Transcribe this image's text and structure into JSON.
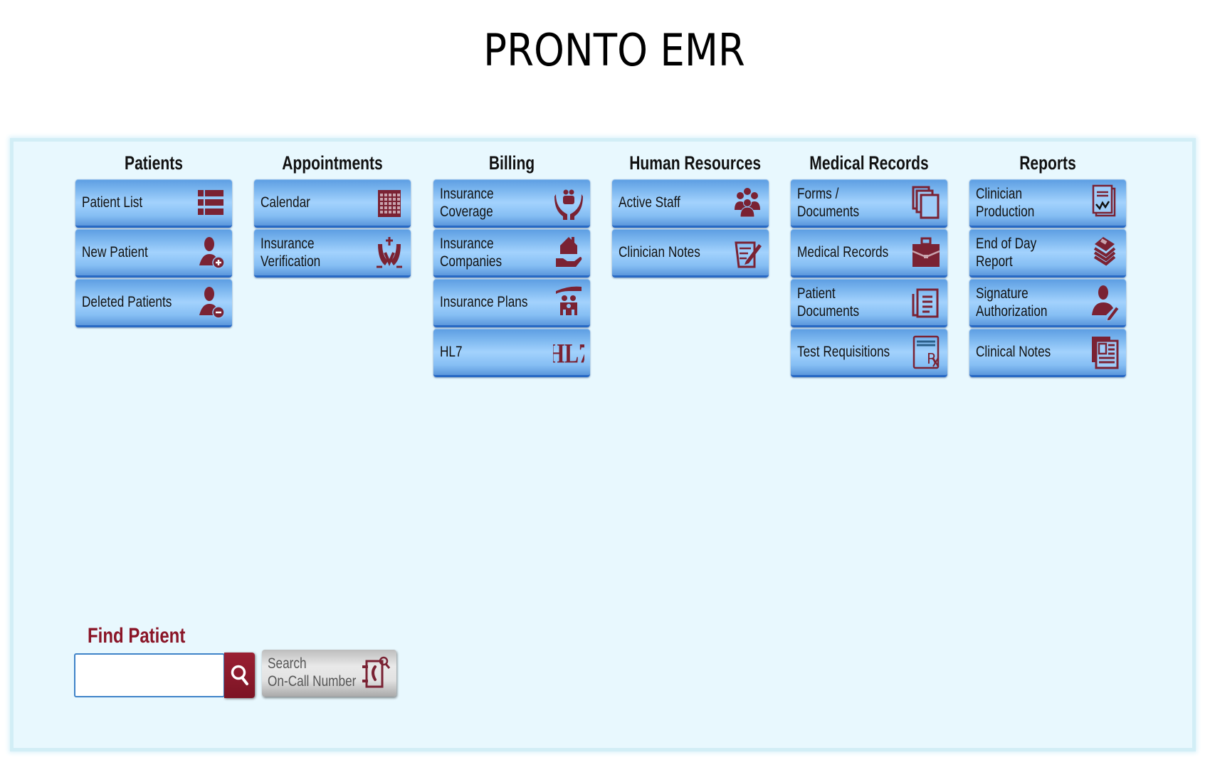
{
  "app": {
    "title": "PRONTO EMR"
  },
  "colors": {
    "icon": "#7a2233",
    "accent_red": "#8a1527",
    "tile_blue": "#a3d2fd",
    "panel_bg": "#e8f8fe"
  },
  "columns": [
    {
      "header": "Patients",
      "tiles": [
        {
          "label": "Patient List",
          "icon": "list-icon"
        },
        {
          "label": "New Patient",
          "icon": "add-user-icon"
        },
        {
          "label": "Deleted Patients",
          "icon": "remove-user-icon"
        }
      ]
    },
    {
      "header": "Appointments",
      "tiles": [
        {
          "label": "Calendar",
          "icon": "calendar-icon"
        },
        {
          "label": "Insurance\nVerification",
          "icon": "hands-cross-icon"
        }
      ]
    },
    {
      "header": "Billing",
      "tiles": [
        {
          "label": "Insurance Coverage",
          "icon": "family-hands-icon"
        },
        {
          "label": "Insurance\nCompanies",
          "icon": "house-hand-icon"
        },
        {
          "label": "Insurance Plans",
          "icon": "family-umbrella-icon"
        },
        {
          "label": "HL7",
          "icon": "hl7-icon"
        }
      ]
    },
    {
      "header": "Human Resources",
      "tiles": [
        {
          "label": "Active Staff",
          "icon": "group-icon"
        },
        {
          "label": "Clinician Notes",
          "icon": "note-pencil-icon"
        }
      ]
    },
    {
      "header": "Medical Records",
      "tiles": [
        {
          "label": "Forms / Documents",
          "icon": "documents-stack-icon"
        },
        {
          "label": "Medical Records",
          "icon": "briefcase-icon"
        },
        {
          "label": "Patient Documents",
          "icon": "document-lines-icon"
        },
        {
          "label": "Test Requisitions",
          "icon": "prescription-icon"
        }
      ]
    },
    {
      "header": "Reports",
      "tiles": [
        {
          "label": "Clinician Production",
          "icon": "report-chart-icon"
        },
        {
          "label": "End of Day Report",
          "icon": "book-stack-icon"
        },
        {
          "label": "Signature\nAuthorization",
          "icon": "user-signature-icon"
        },
        {
          "label": "Clinical Notes",
          "icon": "newspaper-icon"
        }
      ]
    }
  ],
  "find_patient": {
    "label": "Find Patient",
    "input_value": "",
    "input_placeholder": "",
    "search_button_icon": "search-icon",
    "oncall_button_label": "Search\nOn-Call Number",
    "oncall_button_icon": "phonebook-search-icon"
  }
}
